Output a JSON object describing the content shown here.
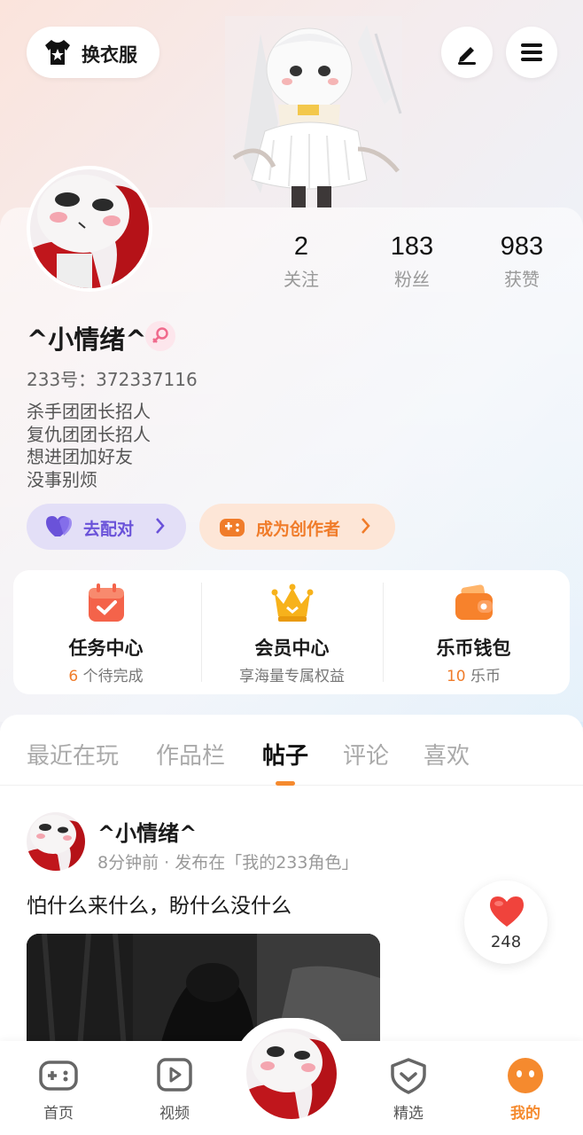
{
  "top_bar": {
    "outfit_label": "换衣服",
    "outfit_icon": "shirt-icon",
    "edit_icon": "pencil-icon",
    "menu_icon": "menu-icon"
  },
  "profile": {
    "stats": [
      {
        "value": "2",
        "label": "关注"
      },
      {
        "value": "183",
        "label": "粉丝"
      },
      {
        "value": "983",
        "label": "获赞"
      }
    ],
    "nickname": "^小情绪^",
    "gender_icon": "female-icon",
    "uid": "233号：372337116",
    "bio": [
      "杀手团团长招人",
      "复仇团团长招人",
      "想进团加好友",
      "没事别烦"
    ]
  },
  "actions": {
    "match_label": "去配对",
    "creator_label": "成为创作者"
  },
  "quick_panel": [
    {
      "title": "任务中心",
      "sub_prefix": "6",
      "sub_suffix": " 个待完成",
      "icon": "task-calendar-icon"
    },
    {
      "title": "会员中心",
      "sub_prefix": "",
      "sub_suffix": "享海量专属权益",
      "icon": "crown-icon"
    },
    {
      "title": "乐币钱包",
      "sub_prefix": "10",
      "sub_suffix": " 乐币",
      "icon": "wallet-icon"
    }
  ],
  "tabs": [
    {
      "label": "最近在玩",
      "active": false
    },
    {
      "label": "作品栏",
      "active": false
    },
    {
      "label": "帖子",
      "active": true
    },
    {
      "label": "评论",
      "active": false
    },
    {
      "label": "喜欢",
      "active": false
    }
  ],
  "post": {
    "author": "^小情绪^",
    "meta": "8分钟前 · 发布在「我的233角色」",
    "text": "怕什么来什么，盼什么没什么",
    "likes": "248"
  },
  "bottom_nav": [
    {
      "label": "首页",
      "icon": "gamepad-icon",
      "active": false
    },
    {
      "label": "视频",
      "icon": "video-play-icon",
      "active": false
    },
    {
      "label": "精选",
      "icon": "heart-badge-icon",
      "active": false
    },
    {
      "label": "我的",
      "icon": "profile-face-icon",
      "active": true
    }
  ],
  "colors": {
    "accent_orange": "#f58a2e",
    "match_purple": "#6a52d9",
    "like_red": "#f0433c"
  }
}
